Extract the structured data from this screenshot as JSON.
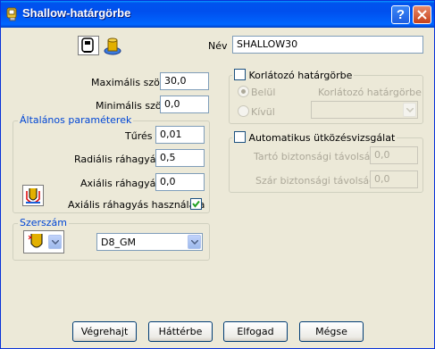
{
  "window": {
    "title": "Shallow-határgörbe",
    "help_label": "?",
    "accent": "#0053ee"
  },
  "header": {
    "name_label": "Név",
    "name_value": "SHALLOW30",
    "icons": [
      "shallow-boundary-tool-icon",
      "shallow-boundary-model-icon"
    ]
  },
  "angles": {
    "max_label": "Maximális szög",
    "max_value": "30,0",
    "min_label": "Minimális szög",
    "min_value": "0,0"
  },
  "general": {
    "title": "Általános paraméterek",
    "tolerance_label": "Tűrés",
    "tolerance_value": "0,01",
    "radial_label": "Radiális ráhagyás",
    "radial_value": "0,5",
    "axial_label": "Axiális ráhagyás",
    "axial_value": "0,0",
    "use_axial_label": "Axiális ráhagyás használata",
    "use_axial_checked": true,
    "icon": "thickness-icon"
  },
  "tool": {
    "title": "Szerszám",
    "selected": "D8_GM",
    "icon": "tool-select-icon"
  },
  "limit": {
    "checkbox_label": "Korlátozó határgörbe",
    "checked": false,
    "inside_label": "Belül",
    "outside_label": "Kívül",
    "boundary_label": "Korlátozó határgörbe",
    "inside_selected": true
  },
  "collision": {
    "checkbox_label": "Automatikus ütközésvizsgálat",
    "checked": false,
    "holder_label": "Tartó biztonsági távolsága",
    "holder_value": "0,0",
    "shank_label": "Szár biztonsági távolsága",
    "shank_value": "0,0"
  },
  "buttons": {
    "apply": "Végrehajt",
    "background": "Háttérbe",
    "accept": "Elfogad",
    "cancel": "Mégse"
  }
}
